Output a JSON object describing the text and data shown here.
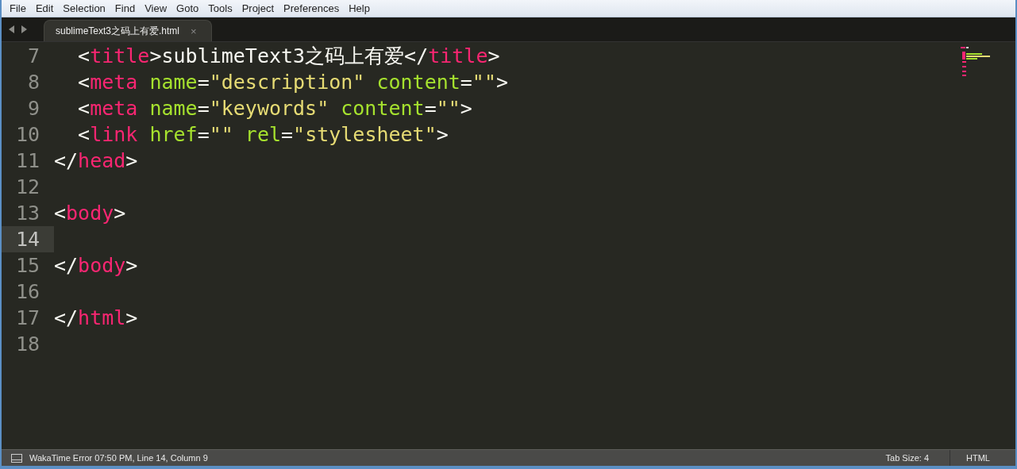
{
  "menu": [
    {
      "label": "File"
    },
    {
      "label": "Edit"
    },
    {
      "label": "Selection"
    },
    {
      "label": "Find"
    },
    {
      "label": "View"
    },
    {
      "label": "Goto"
    },
    {
      "label": "Tools"
    },
    {
      "label": "Project"
    },
    {
      "label": "Preferences"
    },
    {
      "label": "Help"
    }
  ],
  "tabs": [
    {
      "label": "sublimeText3之码上有爱.html",
      "close": "×",
      "selected": true
    }
  ],
  "editor": {
    "lines": [
      {
        "number": "7",
        "current": false,
        "tokens": [
          {
            "kind": "punct",
            "text": "  <"
          },
          {
            "kind": "tag",
            "text": "title"
          },
          {
            "kind": "punct",
            "text": ">sublimeText3之码上有爱</"
          },
          {
            "kind": "tag",
            "text": "title"
          },
          {
            "kind": "punct",
            "text": ">"
          }
        ]
      },
      {
        "number": "8",
        "current": false,
        "tokens": [
          {
            "kind": "punct",
            "text": "  <"
          },
          {
            "kind": "tag",
            "text": "meta"
          },
          {
            "kind": "attr",
            "text": " name"
          },
          {
            "kind": "punct",
            "text": "="
          },
          {
            "kind": "string",
            "text": "\"description\""
          },
          {
            "kind": "attr",
            "text": " content"
          },
          {
            "kind": "punct",
            "text": "="
          },
          {
            "kind": "string",
            "text": "\"\""
          },
          {
            "kind": "punct",
            "text": ">"
          }
        ]
      },
      {
        "number": "9",
        "current": false,
        "tokens": [
          {
            "kind": "punct",
            "text": "  <"
          },
          {
            "kind": "tag",
            "text": "meta"
          },
          {
            "kind": "attr",
            "text": " name"
          },
          {
            "kind": "punct",
            "text": "="
          },
          {
            "kind": "string",
            "text": "\"keywords\""
          },
          {
            "kind": "attr",
            "text": " content"
          },
          {
            "kind": "punct",
            "text": "="
          },
          {
            "kind": "string",
            "text": "\"\""
          },
          {
            "kind": "punct",
            "text": ">"
          }
        ]
      },
      {
        "number": "10",
        "current": false,
        "tokens": [
          {
            "kind": "punct",
            "text": "  <"
          },
          {
            "kind": "tag",
            "text": "link"
          },
          {
            "kind": "attr",
            "text": " href"
          },
          {
            "kind": "punct",
            "text": "="
          },
          {
            "kind": "string",
            "text": "\"\""
          },
          {
            "kind": "attr",
            "text": " rel"
          },
          {
            "kind": "punct",
            "text": "="
          },
          {
            "kind": "string",
            "text": "\"stylesheet\""
          },
          {
            "kind": "punct",
            "text": ">"
          }
        ]
      },
      {
        "number": "11",
        "current": false,
        "tokens": [
          {
            "kind": "punct",
            "text": "</"
          },
          {
            "kind": "tag",
            "text": "head"
          },
          {
            "kind": "punct",
            "text": ">"
          }
        ]
      },
      {
        "number": "12",
        "current": false
      },
      {
        "number": "13",
        "current": false,
        "tokens": [
          {
            "kind": "punct",
            "text": "<"
          },
          {
            "kind": "tag",
            "text": "body"
          },
          {
            "kind": "punct",
            "text": ">"
          }
        ]
      },
      {
        "number": "14",
        "current": true
      },
      {
        "number": "15",
        "current": false,
        "tokens": [
          {
            "kind": "punct",
            "text": "</"
          },
          {
            "kind": "tag",
            "text": "body"
          },
          {
            "kind": "punct",
            "text": ">"
          }
        ]
      },
      {
        "number": "16",
        "current": false
      },
      {
        "number": "17",
        "current": false,
        "tokens": [
          {
            "kind": "punct",
            "text": "</"
          },
          {
            "kind": "tag",
            "text": "html"
          },
          {
            "kind": "punct",
            "text": ">"
          }
        ]
      },
      {
        "number": "18",
        "current": false
      }
    ]
  },
  "status_bar": {
    "message": "WakaTime Error 07:50 PM, Line 14, Column 9",
    "tab_size": "Tab Size: 4",
    "syntax": "HTML"
  }
}
